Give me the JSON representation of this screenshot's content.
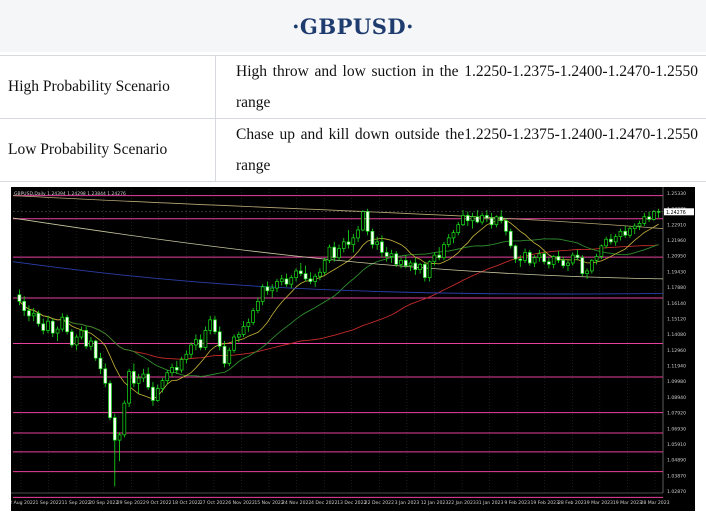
{
  "header": {
    "title": "·GBPUSD·"
  },
  "scenarios": [
    {
      "label": "High Probability Scenario",
      "text": "High throw and low suction in the 1.2250-1.2375-1.2400-1.2470-1.2550 range"
    },
    {
      "label": "Low Probability Scenario",
      "text": "Chase up and kill down outside the1.2250-1.2375-1.2400-1.2470-1.2550 range"
    }
  ],
  "chart_data": {
    "type": "candlestick",
    "symbol_caption": "GBPUSD,Daily  1.24394 1.24298 1.23844 1.24276",
    "x_labels": [
      "22 Aug 2022",
      "1 Sep 2022",
      "11 Sep 2022",
      "20 Sep 2022",
      "29 Sep 2022",
      "9 Oct 2022",
      "18 Oct 2022",
      "27 Oct 2022",
      "6 Nov 2022",
      "15 Nov 2022",
      "24 Nov 2022",
      "4 Dec 2022",
      "13 Dec 2022",
      "22 Dec 2022",
      "3 Jan 2023",
      "12 Jan 2023",
      "22 Jan 2023",
      "31 Jan 2023",
      "9 Feb 2023",
      "19 Feb 2023",
      "28 Feb 2023",
      "9 Mar 2023",
      "19 Mar 2023",
      "28 Mar 2023"
    ],
    "y_labels": [
      "1.25330",
      "1.24276",
      "1.22910",
      "1.21960",
      "1.20950",
      "1.19430",
      "1.17880",
      "1.16140",
      "1.15120",
      "1.14080",
      "1.12960",
      "1.11940",
      "1.09980",
      "1.08940",
      "1.07920",
      "1.06930",
      "1.05910",
      "1.04890",
      "1.03870",
      "1.02870"
    ],
    "last_price": "1.24276",
    "horizontal_levels": [
      1.255,
      1.2375,
      1.2085,
      1.1775,
      1.1431,
      1.1178,
      1.0908,
      1.0754,
      1.0611,
      1.0462,
      1.0267
    ],
    "level_color": "#e8409e",
    "ohlc": [
      [
        1.18,
        1.184,
        1.172,
        1.175
      ],
      [
        1.175,
        1.179,
        1.164,
        1.168
      ],
      [
        1.168,
        1.172,
        1.16,
        1.164
      ],
      [
        1.164,
        1.17,
        1.16,
        1.166
      ],
      [
        1.166,
        1.168,
        1.156,
        1.158
      ],
      [
        1.158,
        1.162,
        1.15,
        1.153
      ],
      [
        1.153,
        1.164,
        1.151,
        1.16
      ],
      [
        1.16,
        1.162,
        1.148,
        1.151
      ],
      [
        1.151,
        1.156,
        1.145,
        1.154
      ],
      [
        1.154,
        1.166,
        1.152,
        1.163
      ],
      [
        1.163,
        1.165,
        1.15,
        1.152
      ],
      [
        1.152,
        1.154,
        1.14,
        1.142
      ],
      [
        1.142,
        1.15,
        1.138,
        1.148
      ],
      [
        1.148,
        1.156,
        1.146,
        1.153
      ],
      [
        1.153,
        1.156,
        1.139,
        1.141
      ],
      [
        1.141,
        1.148,
        1.138,
        1.145
      ],
      [
        1.145,
        1.146,
        1.13,
        1.132
      ],
      [
        1.132,
        1.136,
        1.12,
        1.124
      ],
      [
        1.124,
        1.128,
        1.11,
        1.113
      ],
      [
        1.113,
        1.115,
        1.085,
        1.087
      ],
      [
        1.087,
        1.09,
        1.035,
        1.07
      ],
      [
        1.07,
        1.076,
        1.054,
        1.074
      ],
      [
        1.074,
        1.1,
        1.072,
        1.098
      ],
      [
        1.098,
        1.124,
        1.095,
        1.122
      ],
      [
        1.122,
        1.128,
        1.11,
        1.113
      ],
      [
        1.113,
        1.12,
        1.105,
        1.117
      ],
      [
        1.117,
        1.124,
        1.114,
        1.12
      ],
      [
        1.12,
        1.125,
        1.108,
        1.11
      ],
      [
        1.11,
        1.114,
        1.096,
        1.1
      ],
      [
        1.1,
        1.112,
        1.099,
        1.109
      ],
      [
        1.109,
        1.117,
        1.106,
        1.115
      ],
      [
        1.115,
        1.123,
        1.112,
        1.121
      ],
      [
        1.121,
        1.128,
        1.118,
        1.125
      ],
      [
        1.125,
        1.13,
        1.12,
        1.123
      ],
      [
        1.123,
        1.133,
        1.121,
        1.131
      ],
      [
        1.131,
        1.138,
        1.128,
        1.135
      ],
      [
        1.135,
        1.144,
        1.132,
        1.142
      ],
      [
        1.142,
        1.15,
        1.138,
        1.146
      ],
      [
        1.146,
        1.15,
        1.138,
        1.14
      ],
      [
        1.14,
        1.156,
        1.138,
        1.153
      ],
      [
        1.153,
        1.164,
        1.15,
        1.161
      ],
      [
        1.161,
        1.164,
        1.15,
        1.152
      ],
      [
        1.152,
        1.156,
        1.138,
        1.141
      ],
      [
        1.141,
        1.145,
        1.125,
        1.128
      ],
      [
        1.128,
        1.14,
        1.126,
        1.138
      ],
      [
        1.138,
        1.15,
        1.136,
        1.148
      ],
      [
        1.148,
        1.152,
        1.144,
        1.15
      ],
      [
        1.15,
        1.16,
        1.148,
        1.156
      ],
      [
        1.156,
        1.162,
        1.152,
        1.159
      ],
      [
        1.159,
        1.17,
        1.157,
        1.168
      ],
      [
        1.168,
        1.178,
        1.166,
        1.175
      ],
      [
        1.175,
        1.188,
        1.172,
        1.186
      ],
      [
        1.186,
        1.19,
        1.18,
        1.183
      ],
      [
        1.183,
        1.188,
        1.178,
        1.185
      ],
      [
        1.185,
        1.192,
        1.182,
        1.19
      ],
      [
        1.19,
        1.195,
        1.187,
        1.192
      ],
      [
        1.192,
        1.196,
        1.186,
        1.188
      ],
      [
        1.188,
        1.195,
        1.185,
        1.193
      ],
      [
        1.193,
        1.2,
        1.19,
        1.198
      ],
      [
        1.198,
        1.204,
        1.194,
        1.196
      ],
      [
        1.196,
        1.202,
        1.19,
        1.192
      ],
      [
        1.192,
        1.197,
        1.188,
        1.19
      ],
      [
        1.19,
        1.196,
        1.186,
        1.194
      ],
      [
        1.194,
        1.2,
        1.191,
        1.197
      ],
      [
        1.197,
        1.208,
        1.195,
        1.206
      ],
      [
        1.206,
        1.218,
        1.204,
        1.216
      ],
      [
        1.216,
        1.22,
        1.205,
        1.208
      ],
      [
        1.208,
        1.218,
        1.206,
        1.215
      ],
      [
        1.215,
        1.223,
        1.212,
        1.22
      ],
      [
        1.22,
        1.229,
        1.215,
        1.218
      ],
      [
        1.218,
        1.226,
        1.212,
        1.223
      ],
      [
        1.223,
        1.232,
        1.22,
        1.229
      ],
      [
        1.229,
        1.244,
        1.228,
        1.243
      ],
      [
        1.243,
        1.245,
        1.225,
        1.228
      ],
      [
        1.228,
        1.23,
        1.215,
        1.218
      ],
      [
        1.218,
        1.224,
        1.214,
        1.22
      ],
      [
        1.22,
        1.225,
        1.208,
        1.212
      ],
      [
        1.212,
        1.216,
        1.205,
        1.209
      ],
      [
        1.209,
        1.214,
        1.204,
        1.211
      ],
      [
        1.211,
        1.213,
        1.201,
        1.203
      ],
      [
        1.203,
        1.208,
        1.2,
        1.206
      ],
      [
        1.206,
        1.21,
        1.2,
        1.202
      ],
      [
        1.202,
        1.206,
        1.198,
        1.204
      ],
      [
        1.204,
        1.208,
        1.195,
        1.199
      ],
      [
        1.199,
        1.204,
        1.196,
        1.203
      ],
      [
        1.203,
        1.205,
        1.19,
        1.193
      ],
      [
        1.193,
        1.206,
        1.19,
        1.205
      ],
      [
        1.205,
        1.212,
        1.202,
        1.21
      ],
      [
        1.21,
        1.216,
        1.206,
        1.208
      ],
      [
        1.208,
        1.22,
        1.206,
        1.218
      ],
      [
        1.218,
        1.226,
        1.216,
        1.223
      ],
      [
        1.223,
        1.229,
        1.219,
        1.227
      ],
      [
        1.227,
        1.235,
        1.225,
        1.233
      ],
      [
        1.233,
        1.244,
        1.232,
        1.24
      ],
      [
        1.24,
        1.243,
        1.232,
        1.236
      ],
      [
        1.236,
        1.242,
        1.23,
        1.239
      ],
      [
        1.239,
        1.244,
        1.234,
        1.235
      ],
      [
        1.235,
        1.242,
        1.233,
        1.24
      ],
      [
        1.24,
        1.244,
        1.235,
        1.238
      ],
      [
        1.238,
        1.242,
        1.23,
        1.233
      ],
      [
        1.233,
        1.24,
        1.231,
        1.239
      ],
      [
        1.239,
        1.244,
        1.234,
        1.236
      ],
      [
        1.236,
        1.238,
        1.225,
        1.228
      ],
      [
        1.228,
        1.23,
        1.215,
        1.217
      ],
      [
        1.217,
        1.218,
        1.204,
        1.207
      ],
      [
        1.207,
        1.21,
        1.201,
        1.206
      ],
      [
        1.206,
        1.215,
        1.204,
        1.212
      ],
      [
        1.212,
        1.214,
        1.202,
        1.204
      ],
      [
        1.204,
        1.21,
        1.201,
        1.208
      ],
      [
        1.208,
        1.214,
        1.205,
        1.211
      ],
      [
        1.211,
        1.213,
        1.203,
        1.205
      ],
      [
        1.205,
        1.208,
        1.2,
        1.203
      ],
      [
        1.203,
        1.21,
        1.2,
        1.209
      ],
      [
        1.209,
        1.213,
        1.204,
        1.206
      ],
      [
        1.206,
        1.209,
        1.2,
        1.202
      ],
      [
        1.202,
        1.206,
        1.198,
        1.204
      ],
      [
        1.204,
        1.212,
        1.202,
        1.21
      ],
      [
        1.21,
        1.214,
        1.206,
        1.208
      ],
      [
        1.208,
        1.21,
        1.194,
        1.196
      ],
      [
        1.196,
        1.2,
        1.192,
        1.198
      ],
      [
        1.198,
        1.207,
        1.196,
        1.206
      ],
      [
        1.206,
        1.211,
        1.203,
        1.209
      ],
      [
        1.209,
        1.218,
        1.207,
        1.217
      ],
      [
        1.217,
        1.224,
        1.215,
        1.222
      ],
      [
        1.222,
        1.226,
        1.218,
        1.22
      ],
      [
        1.22,
        1.226,
        1.217,
        1.224
      ],
      [
        1.224,
        1.23,
        1.221,
        1.228
      ],
      [
        1.228,
        1.232,
        1.223,
        1.225
      ],
      [
        1.225,
        1.232,
        1.223,
        1.23
      ],
      [
        1.23,
        1.234,
        1.226,
        1.232
      ],
      [
        1.232,
        1.236,
        1.229,
        1.234
      ],
      [
        1.234,
        1.242,
        1.232,
        1.239
      ],
      [
        1.239,
        1.243,
        1.235,
        1.237
      ],
      [
        1.237,
        1.244,
        1.236,
        1.243
      ],
      [
        1.243,
        1.245,
        1.238,
        1.2428
      ]
    ]
  }
}
